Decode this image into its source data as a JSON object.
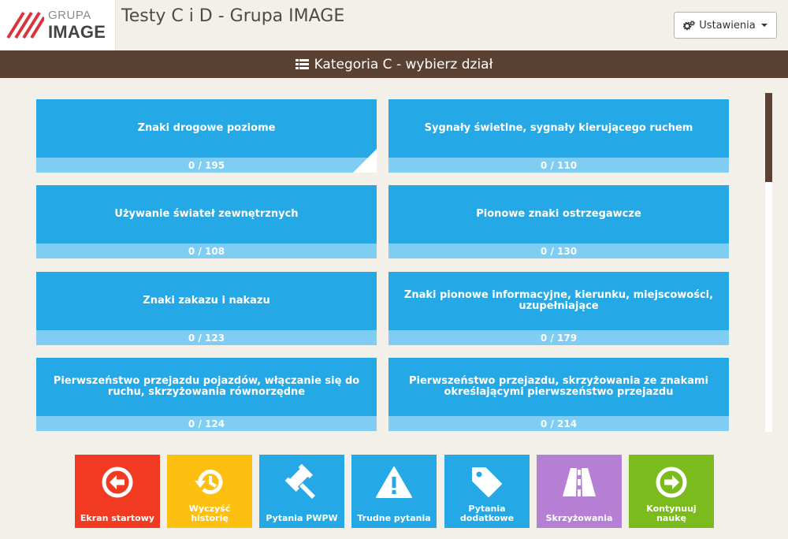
{
  "header": {
    "logo_line1": "GRUPA",
    "logo_line2": "IMAGE",
    "title": "Testy C i D - Grupa IMAGE",
    "settings_label": "Ustawienia"
  },
  "category_bar": {
    "title": "Kategoria C - wybierz dział"
  },
  "tiles": [
    {
      "title": "Znaki drogowe poziome",
      "progress": "0 / 195"
    },
    {
      "title": "Sygnały świetlne, sygnały kierującego ruchem",
      "progress": "0 / 110"
    },
    {
      "title": "Używanie świateł zewnętrznych",
      "progress": "0 / 108"
    },
    {
      "title": "Pionowe znaki ostrzegawcze",
      "progress": "0 / 130"
    },
    {
      "title": "Znaki zakazu i nakazu",
      "progress": "0 / 123"
    },
    {
      "title": "Znaki pionowe informacyjne, kierunku, miejscowości, uzupełniające",
      "progress": "0 / 179"
    },
    {
      "title": "Pierwszeństwo przejazdu pojazdów, włączanie się do ruchu, skrzyżowania równorzędne",
      "progress": "0 / 124"
    },
    {
      "title": "Pierwszeństwo przejazdu, skrzyżowania ze znakami określającymi pierwszeństwo przejazdu",
      "progress": "0 / 214"
    }
  ],
  "bottom_buttons": [
    {
      "label": "Ekran startowy",
      "icon": "arrow-left-circle-icon",
      "color": "#f03b22"
    },
    {
      "label": "Wyczyść historię",
      "icon": "history-icon",
      "color": "#fdc010"
    },
    {
      "label": "Pytania PWPW",
      "icon": "gavel-icon",
      "color": "#24a8e6"
    },
    {
      "label": "Trudne pytania",
      "icon": "warning-icon",
      "color": "#24a8e6"
    },
    {
      "label": "Pytania dodatkowe",
      "icon": "tag-icon",
      "color": "#24a8e6"
    },
    {
      "label": "Skrzyżowania",
      "icon": "road-icon",
      "color": "#b57fd3"
    },
    {
      "label": "Kontynuuj naukę",
      "icon": "arrow-right-circle-icon",
      "color": "#7bbb1d"
    }
  ],
  "colors": {
    "accent_brown": "#5b4132",
    "tile_blue": "#24a8e6",
    "tile_progress": "#7fcdf3",
    "background": "#f3efe9"
  }
}
